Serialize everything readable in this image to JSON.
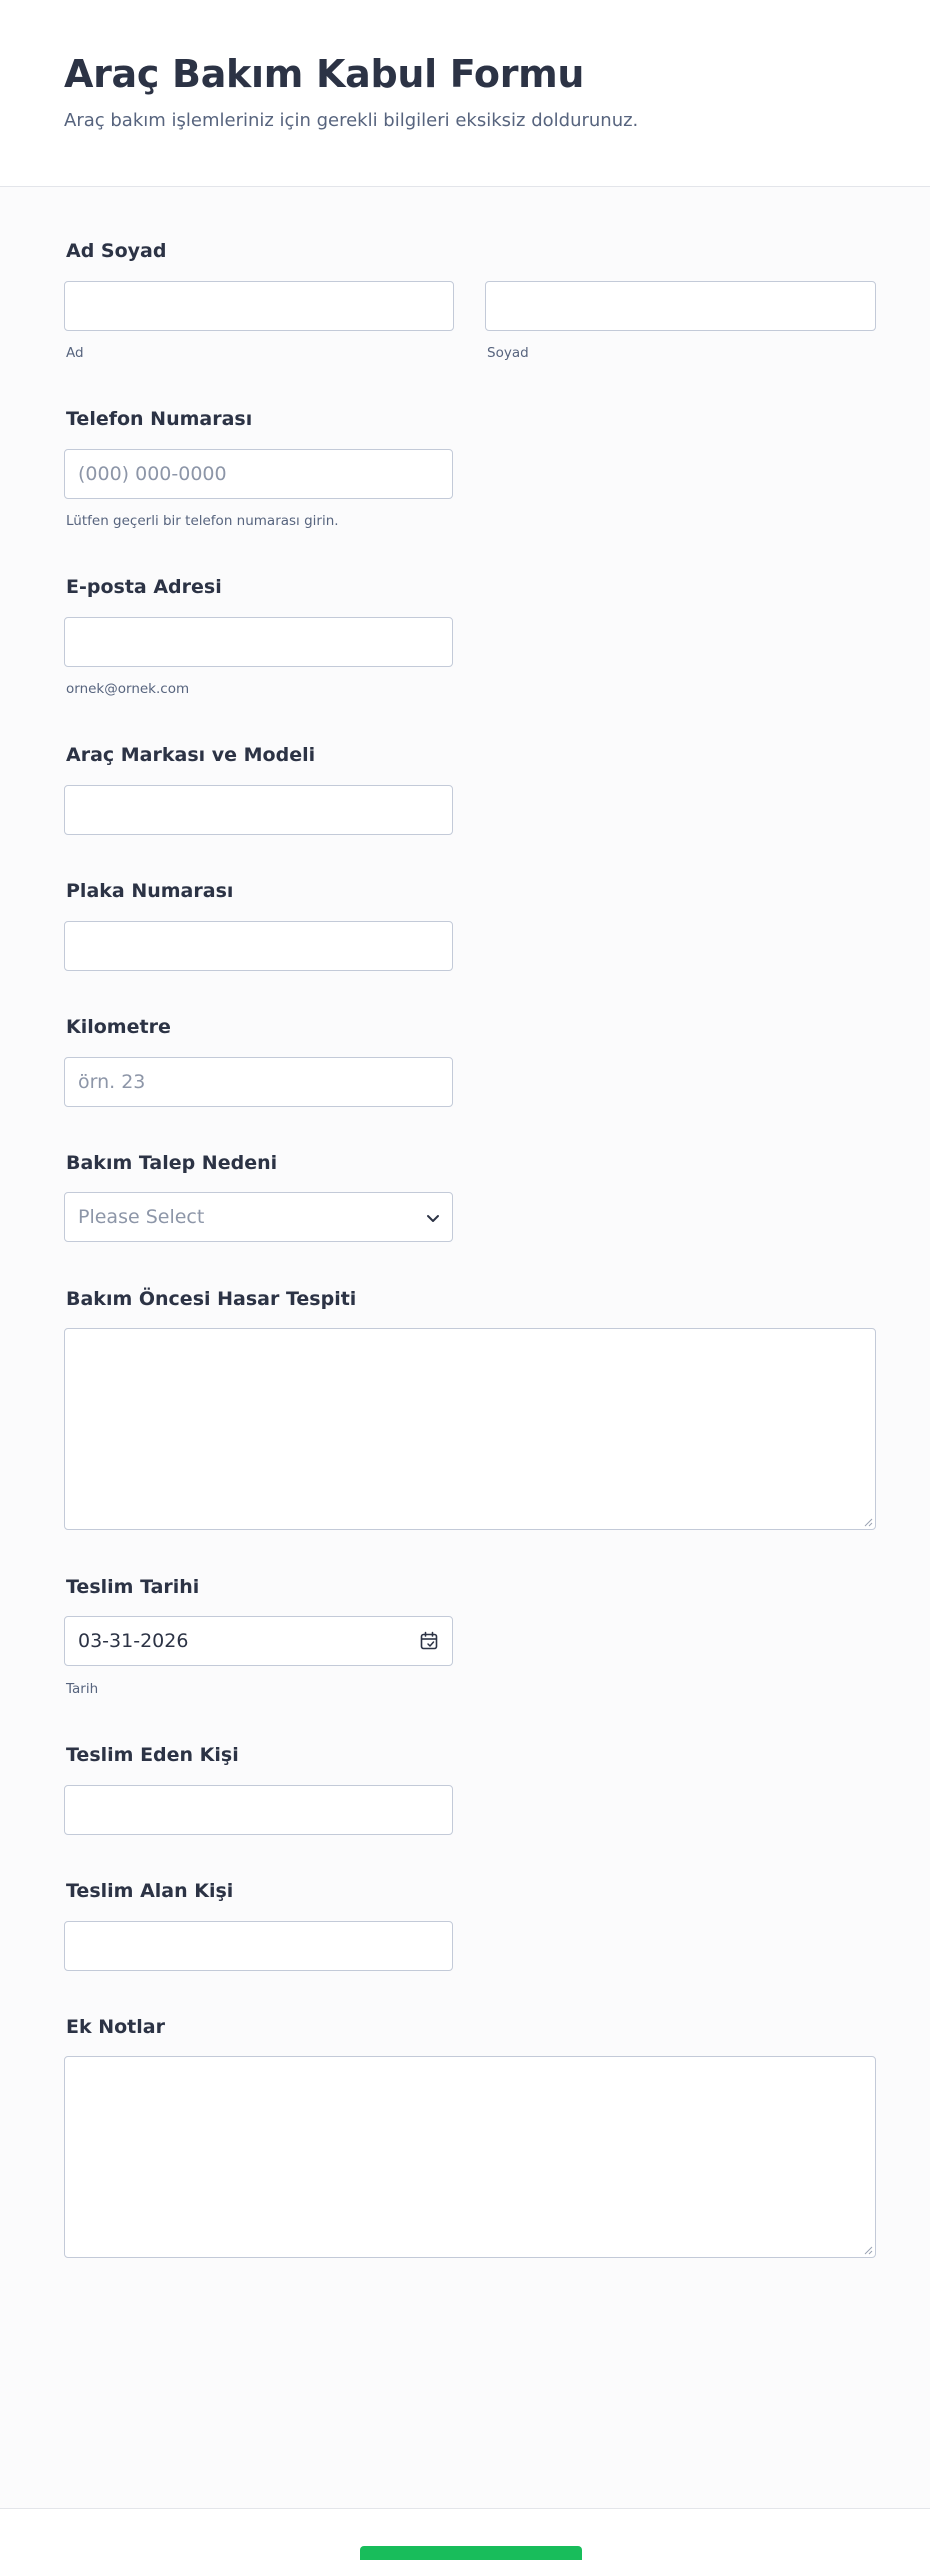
{
  "header": {
    "title": "Araç Bakım Kabul Formu",
    "subtitle": "Araç bakım işlemleriniz için gerekli bilgileri eksiksiz doldurunuz."
  },
  "fields": {
    "name": {
      "label": "Ad Soyad",
      "first_sublabel": "Ad",
      "last_sublabel": "Soyad",
      "first_value": "",
      "last_value": ""
    },
    "phone": {
      "label": "Telefon Numarası",
      "placeholder": "(000) 000-0000",
      "sublabel": "Lütfen geçerli bir telefon numarası girin.",
      "value": ""
    },
    "email": {
      "label": "E-posta Adresi",
      "sublabel": "ornek@ornek.com",
      "value": ""
    },
    "vehicle": {
      "label": "Araç Markası ve Modeli",
      "value": ""
    },
    "plate": {
      "label": "Plaka Numarası",
      "value": ""
    },
    "mileage": {
      "label": "Kilometre",
      "placeholder": "örn. 23",
      "value": ""
    },
    "reason": {
      "label": "Bakım Talep Nedeni",
      "selected": "Please Select"
    },
    "damage": {
      "label": "Bakım Öncesi Hasar Tespiti",
      "value": ""
    },
    "delivery_date": {
      "label": "Teslim Tarihi",
      "value": "03-31-2026",
      "sublabel": "Tarih"
    },
    "delivered_by": {
      "label": "Teslim Eden Kişi",
      "value": ""
    },
    "received_by": {
      "label": "Teslim Alan Kişi",
      "value": ""
    },
    "notes": {
      "label": "Ek Notlar",
      "value": ""
    }
  },
  "footer": {
    "submit_label": ""
  },
  "colors": {
    "title": "#2c3345",
    "subtitle": "#57647e",
    "input_border": "#c3cad8",
    "placeholder": "#8d96a8",
    "submit_button": "#18bd5b"
  },
  "icons": {
    "select": "chevron-down-icon",
    "date": "calendar-icon",
    "textarea": "resize-grip-icon"
  }
}
